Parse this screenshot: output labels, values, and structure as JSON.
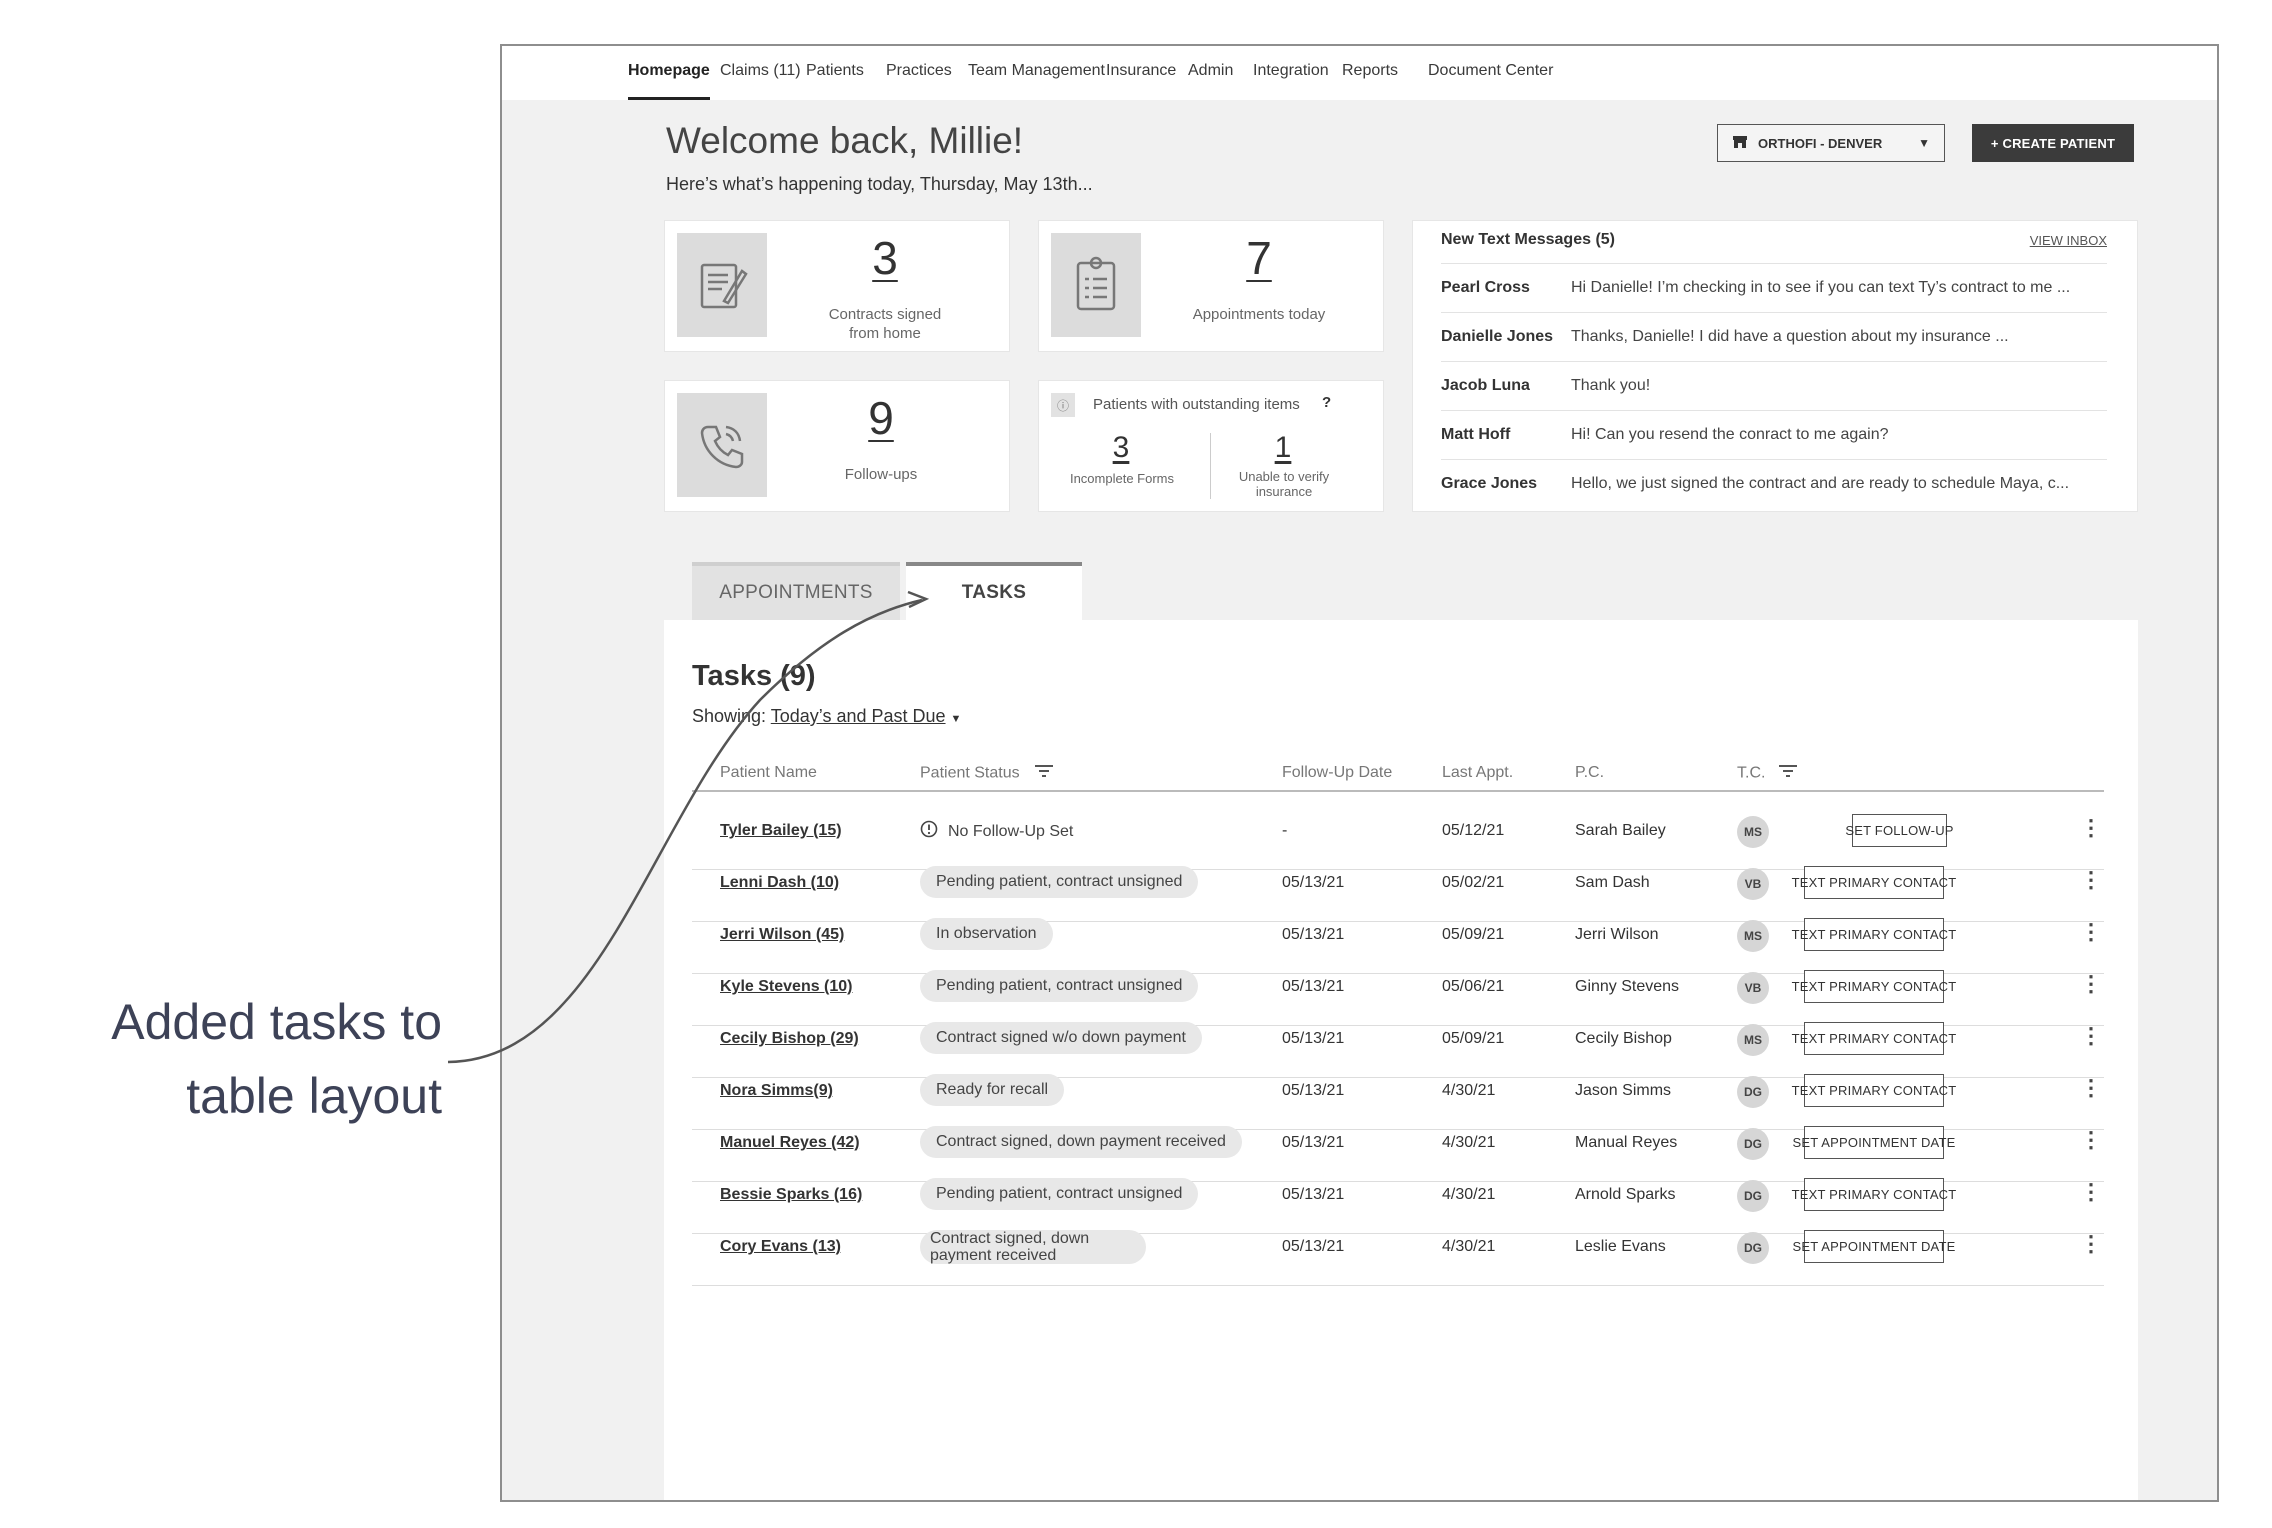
{
  "annotation": {
    "line1": "Added tasks to",
    "line2": "table layout"
  },
  "nav": {
    "items": [
      {
        "label": "Homepage",
        "active": true
      },
      {
        "label": "Claims (11)"
      },
      {
        "label": "Patients"
      },
      {
        "label": "Practices"
      },
      {
        "label": "Team Management"
      },
      {
        "label": "Insurance"
      },
      {
        "label": "Admin"
      },
      {
        "label": "Integration"
      },
      {
        "label": "Reports"
      },
      {
        "label": "Document Center"
      }
    ]
  },
  "header": {
    "welcome": "Welcome back, Millie!",
    "subtitle": "Here’s what’s happening today, Thursday, May 13th...",
    "practice": "ORTHOFI - DENVER",
    "create_button": "+ CREATE PATIENT"
  },
  "stats": {
    "contracts": {
      "value": "3",
      "label_line1": "Contracts signed",
      "label_line2": "from home",
      "icon": "contract-icon"
    },
    "appointments": {
      "value": "7",
      "label": "Appointments today",
      "icon": "clipboard-icon"
    },
    "followups": {
      "value": "9",
      "label": "Follow-ups",
      "icon": "phone-icon"
    },
    "outstanding": {
      "title": "Patients with outstanding items",
      "incomplete_value": "3",
      "incomplete_label": "Incomplete Forms",
      "unverified_value": "1",
      "unverified_label_line1": "Unable to verify",
      "unverified_label_line2": "insurance"
    }
  },
  "messages": {
    "title": "New Text Messages (5)",
    "view_inbox": "VIEW INBOX",
    "items": [
      {
        "sender": "Pearl Cross",
        "text": "Hi Danielle! I’m checking in to see if you can text Ty’s contract to me ..."
      },
      {
        "sender": "Danielle Jones",
        "text": "Thanks, Danielle! I did have a question about my insurance ..."
      },
      {
        "sender": "Jacob Luna",
        "text": "Thank you!"
      },
      {
        "sender": "Matt Hoff",
        "text": "Hi! Can you resend the conract to me again?"
      },
      {
        "sender": "Grace Jones",
        "text": "Hello, we just signed the contract and are ready to schedule Maya, c..."
      }
    ]
  },
  "tabs": {
    "appointments": "APPOINTMENTS",
    "tasks": "TASKS"
  },
  "tasks": {
    "title": "Tasks (9)",
    "showing_label": "Showing:",
    "showing_value": "Today’s and Past Due",
    "columns": {
      "name": "Patient Name",
      "status": "Patient Status",
      "followup": "Follow-Up Date",
      "last_appt": "Last Appt.",
      "pc": "P.C.",
      "tc": "T.C."
    },
    "rows": [
      {
        "name": "Tyler Bailey (15)",
        "status": "No Follow-Up Set",
        "status_style": "plain",
        "followup": "-",
        "last_appt": "05/12/21",
        "pc": "Sarah Bailey",
        "tc": "MS",
        "action": "SET FOLLOW-UP"
      },
      {
        "name": "Lenni Dash (10)",
        "status": "Pending patient, contract unsigned",
        "status_style": "pill",
        "followup": "05/13/21",
        "last_appt": "05/02/21",
        "pc": "Sam Dash",
        "tc": "VB",
        "action": "TEXT PRIMARY CONTACT"
      },
      {
        "name": "Jerri Wilson (45)",
        "status": "In observation",
        "status_style": "pill",
        "followup": "05/13/21",
        "last_appt": "05/09/21",
        "pc": "Jerri Wilson",
        "tc": "MS",
        "action": "TEXT PRIMARY CONTACT"
      },
      {
        "name": "Kyle Stevens (10)",
        "status": "Pending patient, contract unsigned",
        "status_style": "pill",
        "followup": "05/13/21",
        "last_appt": "05/06/21",
        "pc": "Ginny Stevens",
        "tc": "VB",
        "action": "TEXT PRIMARY CONTACT"
      },
      {
        "name": "Cecily Bishop (29)",
        "status": "Contract signed w/o down payment",
        "status_style": "pill",
        "followup": "05/13/21",
        "last_appt": "05/09/21",
        "pc": "Cecily Bishop",
        "tc": "MS",
        "action": "TEXT PRIMARY CONTACT"
      },
      {
        "name": "Nora Simms(9)",
        "status": "Ready for recall",
        "status_style": "pill",
        "followup": "05/13/21",
        "last_appt": "4/30/21",
        "pc": "Jason Simms",
        "tc": "DG",
        "action": "TEXT PRIMARY CONTACT"
      },
      {
        "name": "Manuel Reyes (42)",
        "status": "Contract signed, down payment received",
        "status_style": "pill",
        "followup": "05/13/21",
        "last_appt": "4/30/21",
        "pc": "Manual Reyes",
        "tc": "DG",
        "action": "SET APPOINTMENT DATE"
      },
      {
        "name": "Bessie Sparks (16)",
        "status": "Pending patient, contract unsigned",
        "status_style": "pill",
        "followup": "05/13/21",
        "last_appt": "4/30/21",
        "pc": "Arnold Sparks",
        "tc": "DG",
        "action": "TEXT PRIMARY CONTACT"
      },
      {
        "name": "Cory Evans (13)",
        "status": "Contract signed, down payment received",
        "status_style": "pill-wrap",
        "followup": "05/13/21",
        "last_appt": "4/30/21",
        "pc": "Leslie Evans",
        "tc": "DG",
        "action": "SET APPOINTMENT DATE"
      }
    ]
  }
}
